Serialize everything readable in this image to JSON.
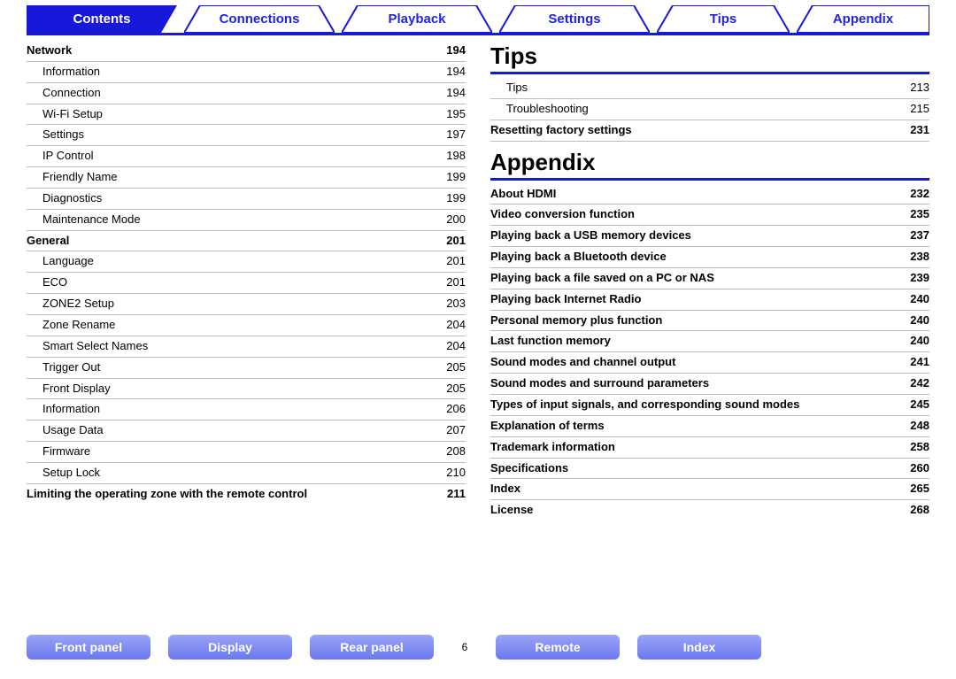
{
  "tabs": {
    "contents": "Contents",
    "connections": "Connections",
    "playback": "Playback",
    "settings": "Settings",
    "tips": "Tips",
    "appendix": "Appendix"
  },
  "left": {
    "network": {
      "label": "Network",
      "page": "194"
    },
    "network_items": [
      {
        "label": "Information",
        "page": "194"
      },
      {
        "label": "Connection",
        "page": "194"
      },
      {
        "label": "Wi-Fi Setup",
        "page": "195"
      },
      {
        "label": "Settings",
        "page": "197"
      },
      {
        "label": "IP Control",
        "page": "198"
      },
      {
        "label": "Friendly Name",
        "page": "199"
      },
      {
        "label": "Diagnostics",
        "page": "199"
      },
      {
        "label": "Maintenance Mode",
        "page": "200"
      }
    ],
    "general": {
      "label": "General",
      "page": "201"
    },
    "general_items": [
      {
        "label": "Language",
        "page": "201"
      },
      {
        "label": "ECO",
        "page": "201"
      },
      {
        "label": "ZONE2 Setup",
        "page": "203"
      },
      {
        "label": "Zone Rename",
        "page": "204"
      },
      {
        "label": "Smart Select Names",
        "page": "204"
      },
      {
        "label": "Trigger Out",
        "page": "205"
      },
      {
        "label": "Front Display",
        "page": "205"
      },
      {
        "label": "Information",
        "page": "206"
      },
      {
        "label": "Usage Data",
        "page": "207"
      },
      {
        "label": "Firmware",
        "page": "208"
      },
      {
        "label": "Setup Lock",
        "page": "210"
      }
    ],
    "limiting": {
      "label": "Limiting the operating zone with the remote control",
      "page": "211"
    }
  },
  "right": {
    "tips_heading": "Tips",
    "tips_items": [
      {
        "label": "Tips",
        "page": "213"
      },
      {
        "label": "Troubleshooting",
        "page": "215"
      }
    ],
    "resetting": {
      "label": "Resetting factory settings",
      "page": "231"
    },
    "appendix_heading": "Appendix",
    "appendix_items": [
      {
        "label": "About HDMI",
        "page": "232"
      },
      {
        "label": "Video conversion function",
        "page": "235"
      },
      {
        "label": "Playing back a USB memory devices",
        "page": "237"
      },
      {
        "label": "Playing back a Bluetooth device",
        "page": "238"
      },
      {
        "label": "Playing back a file saved on a PC or NAS",
        "page": "239"
      },
      {
        "label": "Playing back Internet Radio",
        "page": "240"
      },
      {
        "label": "Personal memory plus function",
        "page": "240"
      },
      {
        "label": "Last function memory",
        "page": "240"
      },
      {
        "label": "Sound modes and channel output",
        "page": "241"
      },
      {
        "label": "Sound modes and surround parameters",
        "page": "242"
      },
      {
        "label": "Types of input signals, and corresponding sound modes",
        "page": "245"
      },
      {
        "label": "Explanation of terms",
        "page": "248"
      },
      {
        "label": "Trademark information",
        "page": "258"
      },
      {
        "label": "Specifications",
        "page": "260"
      },
      {
        "label": "Index",
        "page": "265"
      },
      {
        "label": "License",
        "page": "268"
      }
    ]
  },
  "bottom": {
    "front_panel": "Front panel",
    "display": "Display",
    "rear_panel": "Rear panel",
    "page_number": "6",
    "remote": "Remote",
    "index": "Index"
  }
}
